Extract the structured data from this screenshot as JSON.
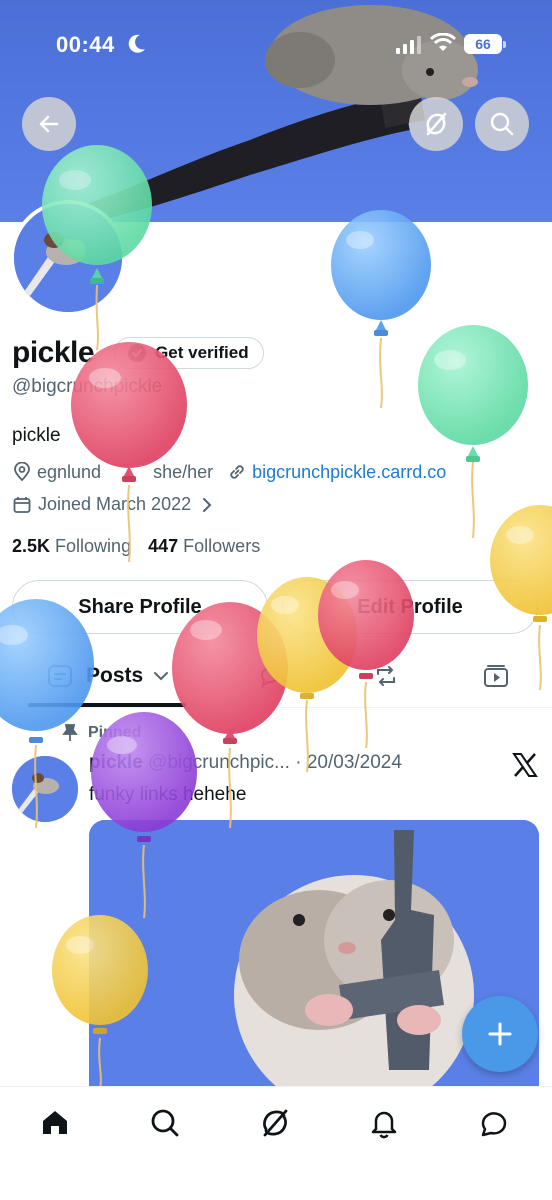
{
  "status_bar": {
    "time": "00:44",
    "battery": "66"
  },
  "header": {
    "back_icon": "back-arrow-icon",
    "grok_icon": "grok-icon",
    "search_icon": "search-icon"
  },
  "profile": {
    "display_name": "pickle",
    "verify_label": "Get verified",
    "handle": "@bigcrunchpickle",
    "bio": "pickle",
    "location": "egnlund",
    "pronouns": "she/her",
    "website": "bigcrunchpickle.carrd.co",
    "joined": "Joined March 2022",
    "following_count": "2.5K",
    "following_label": "Following",
    "followers_count": "447",
    "followers_label": "Followers"
  },
  "actions": {
    "share": "Share Profile",
    "edit": "Edit Profile"
  },
  "tabs": {
    "posts": "Posts"
  },
  "post": {
    "pinned_label": "Pinned",
    "author_name": "pickle",
    "author_handle": "@bigcrunchpic...",
    "separator": "·",
    "date": "20/03/2024",
    "text": "funky links hehehe"
  },
  "colors": {
    "banner": "#5a80e8",
    "link": "#1d7bd3",
    "fab": "#4a99e9",
    "balloon_green": "#6ee6b0",
    "balloon_blue": "#5aa8f5",
    "balloon_red": "#e8506e",
    "balloon_yellow": "#f5cf45",
    "balloon_purple": "#9d4fe0"
  },
  "bottom_nav": [
    "home-icon",
    "search-icon",
    "grok-icon",
    "notifications-icon",
    "messages-icon"
  ]
}
